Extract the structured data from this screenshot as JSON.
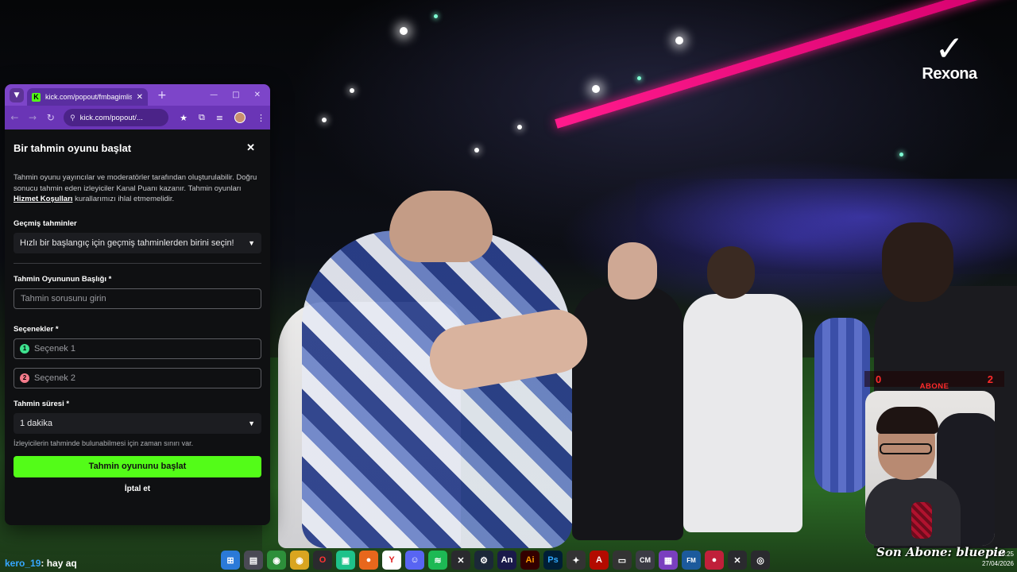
{
  "overlay": {
    "sponsor_logo": "Rexona",
    "abone_current": "0",
    "abone_label": "ABONE",
    "abone_goal": "2",
    "son_abone": "Son Abone: bluepie",
    "chat_user": "kero_19",
    "chat_message": ": hay aq",
    "colors": {
      "accent_green": "#53fc18",
      "abone_red": "#ff2a2a",
      "browser_purple": "#7d45c9"
    }
  },
  "browser": {
    "tab_title": "kick.com/popout/fmbagimlisi/c",
    "address": "kick.com/popout/...",
    "icons": [
      "tab-search-icon",
      "kick-favicon-icon",
      "close-icon",
      "new-tab-icon",
      "minimize-icon",
      "maximize-icon",
      "window-close-icon",
      "back-icon",
      "forward-icon",
      "reload-icon",
      "site-info-icon",
      "star-icon",
      "extension-icon",
      "media-icon",
      "profile-avatar",
      "kebab-menu-icon"
    ]
  },
  "dialog": {
    "title": "Bir tahmin oyunu başlat",
    "desc_part1": "Tahmin oyunu yayıncılar ve moderatörler tarafından oluşturulabilir. Doğru sonucu tahmin eden izleyiciler Kanal Puanı kazanır. Tahmin oyunları ",
    "desc_link": "Hizmet Koşulları",
    "desc_part2": " kurallarımızı ihlal etmemelidir.",
    "past_label": "Geçmiş tahminler",
    "past_select": "Hızlı bir başlangıç için geçmiş tahminlerden birini seçin!",
    "title_label": "Tahmin Oyununun Başlığı *",
    "title_placeholder": "Tahmin sorusunu girin",
    "options_label": "Seçenekler *",
    "option1_num": "1",
    "option1_placeholder": "Seçenek 1",
    "option2_num": "2",
    "option2_placeholder": "Seçenek 2",
    "duration_label": "Tahmin süresi *",
    "duration_value": "1 dakika",
    "duration_hint": "İzleyicilerin tahminde bulunabilmesi için zaman sınırı var.",
    "start_button": "Tahmin oyununu başlat",
    "cancel_button": "İptal et"
  },
  "taskbar": {
    "icons": [
      "windows-start-icon",
      "file-icon",
      "chrome-icon",
      "chrome-icon",
      "opera-icon",
      "app-icon",
      "firefox-icon",
      "yandex-icon",
      "discord-icon",
      "spotify-icon",
      "capcut-icon",
      "steam-icon",
      "animate-icon",
      "illustrator-icon",
      "photoshop-icon",
      "settings-icon",
      "acrobat-icon",
      "camera-icon",
      "cm-icon",
      "app-icon",
      "fm-icon",
      "record-icon",
      "capcut-icon",
      "obs-icon"
    ],
    "labels": [
      "An",
      "Ai",
      "Ps"
    ],
    "time": "20:25",
    "date": "27/04/2026"
  }
}
